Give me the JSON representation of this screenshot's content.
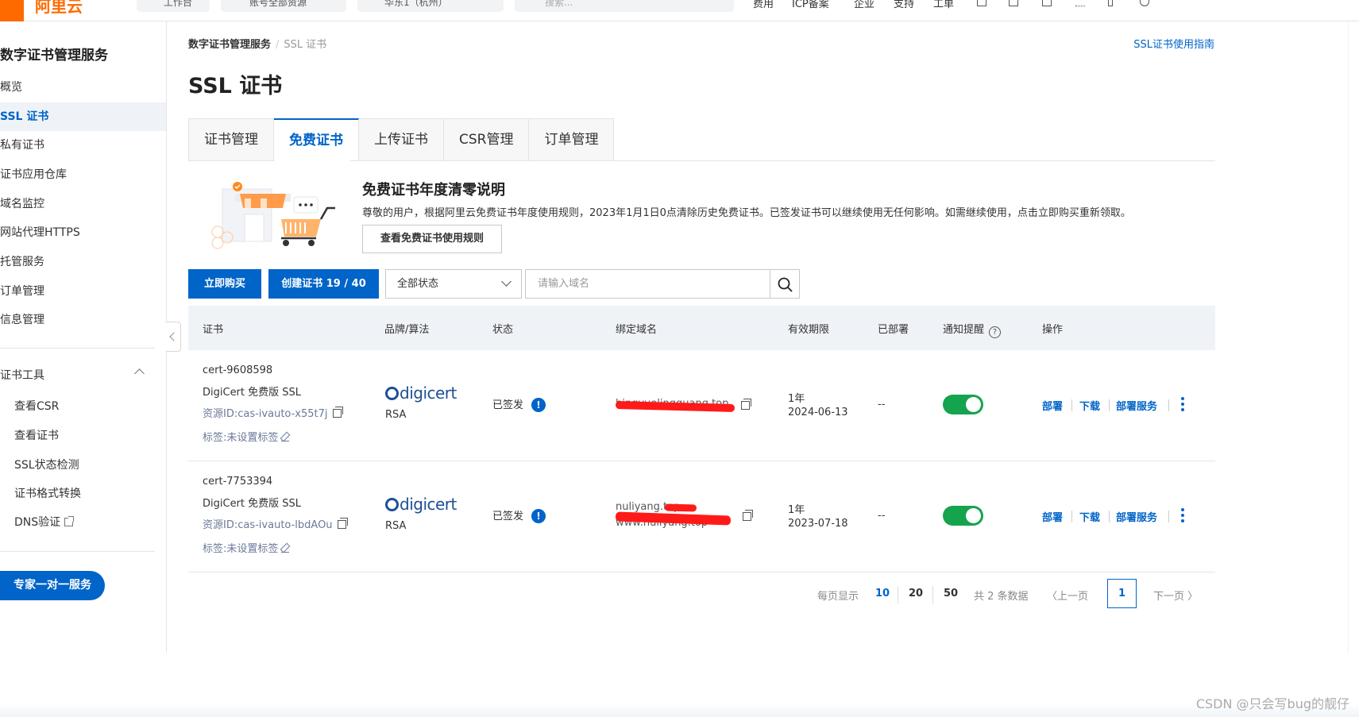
{
  "topbar": {
    "logo_text": "阿里云",
    "pill_1": "工作台",
    "pill_2": "账号全部资源",
    "pill_3": "华东1（杭州）",
    "search_placeholder": "搜索...",
    "menu": [
      "费用",
      "ICP备案",
      "企业",
      "支持",
      "工单"
    ],
    "brand_color": "#ff6a00"
  },
  "sidebar": {
    "title": "数字证书管理服务",
    "items": [
      {
        "label": "概览"
      },
      {
        "label": "SSL 证书",
        "active": true
      },
      {
        "label": "私有证书"
      },
      {
        "label": "证书应用仓库"
      },
      {
        "label": "域名监控"
      },
      {
        "label": "网站代理HTTPS"
      },
      {
        "label": "托管服务"
      },
      {
        "label": "订单管理"
      },
      {
        "label": "信息管理"
      }
    ],
    "group_label": "证书工具",
    "tools": [
      {
        "label": "查看CSR"
      },
      {
        "label": "查看证书"
      },
      {
        "label": "SSL状态检测"
      },
      {
        "label": "证书格式转换"
      },
      {
        "label": "DNS验证"
      }
    ],
    "expert_button": "专家一对一服务"
  },
  "breadcrumb": {
    "root": "数字证书管理服务",
    "current": "SSL 证书"
  },
  "guide_link": "SSL证书使用指南",
  "page_title": "SSL 证书",
  "tabs": [
    {
      "label": "证书管理"
    },
    {
      "label": "免费证书",
      "active": true
    },
    {
      "label": "上传证书"
    },
    {
      "label": "CSR管理"
    },
    {
      "label": "订单管理"
    }
  ],
  "notice": {
    "title": "免费证书年度清零说明",
    "text": "尊敬的用户，根据阿里云免费证书年度使用规则，2023年1月1日0点清除历史免费证书。已签发证书可以继续使用无任何影响。如需继续使用，点击立即购买重新领取。",
    "button": "查看免费证书使用规则"
  },
  "toolbar": {
    "buy_button": "立即购买",
    "create_button": "创建证书 19 / 40",
    "status_select": "全部状态",
    "search_placeholder": "请输入域名"
  },
  "table": {
    "headers": {
      "cert": "证书",
      "brand": "品牌/算法",
      "status": "状态",
      "domain": "绑定域名",
      "validity": "有效期限",
      "deployed": "已部署",
      "notify": "通知提醒",
      "actions": "操作"
    },
    "rows": [
      {
        "cert_id": "cert-9608598",
        "cert_name": "DigiCert 免费版 SSL",
        "resource_id": "资源ID:cas-ivauto-x55t7j",
        "tag": "标签:未设置标签",
        "brand": "digicert",
        "algorithm": "RSA",
        "status": "已签发",
        "domain": "bingyuelingguang.top",
        "validity_period": "1年",
        "validity_date": "2024-06-13",
        "deployed": "--",
        "notify_on": true,
        "actions": [
          "部署",
          "下载",
          "部署服务"
        ]
      },
      {
        "cert_id": "cert-7753394",
        "cert_name": "DigiCert 免费版 SSL",
        "resource_id": "资源ID:cas-ivauto-lbdAOu",
        "tag": "标签:未设置标签",
        "brand": "digicert",
        "algorithm": "RSA",
        "status": "已签发",
        "domain_line1": "nuliyang.top",
        "domain_line2": "www.nuliyang.top",
        "validity_period": "1年",
        "validity_date": "2023-07-18",
        "deployed": "--",
        "notify_on": true,
        "actions": [
          "部署",
          "下载",
          "部署服务"
        ]
      }
    ]
  },
  "pagination": {
    "page_size_label": "每页显示",
    "sizes": [
      "10",
      "20",
      "50"
    ],
    "total": "共 2 条数据",
    "prev": "〈上一页",
    "current_page": "1",
    "next": "下一页 〉"
  },
  "watermark": "CSDN @只会写bug的靓仔",
  "colors": {
    "primary": "#0064c8",
    "toggle_on": "#14a44d",
    "redaction": "#ff1a1a"
  }
}
